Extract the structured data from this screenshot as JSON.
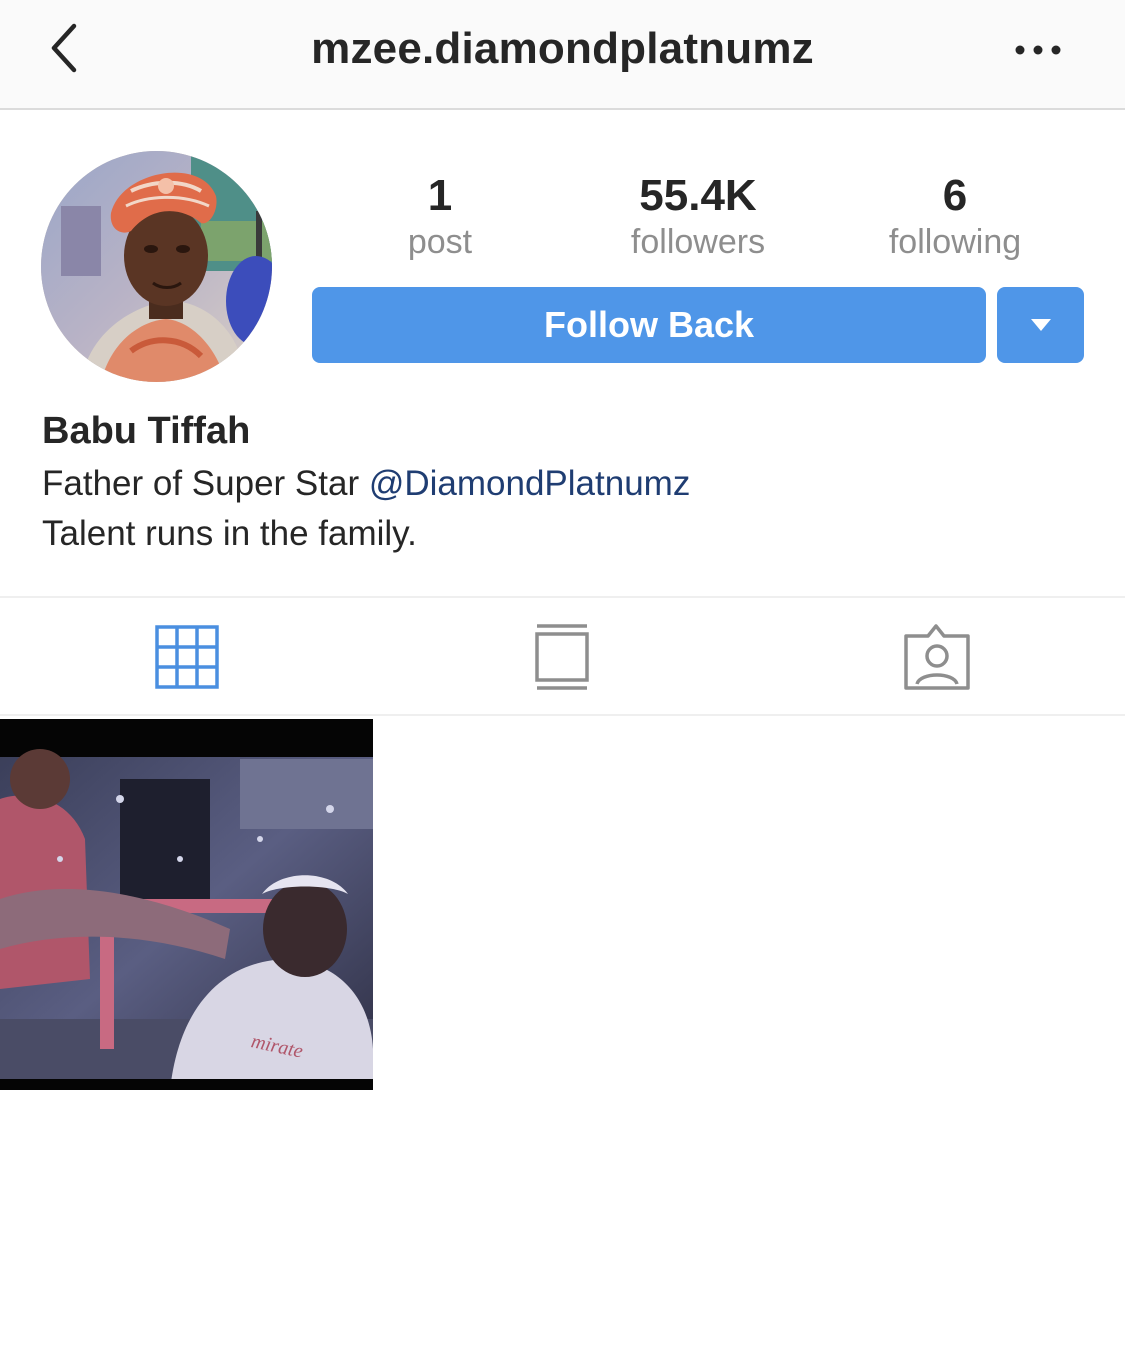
{
  "header": {
    "username": "mzee.diamondplatnumz",
    "back_icon": "chevron-left-icon",
    "more_icon": "more-horizontal-icon"
  },
  "profile": {
    "stats": {
      "posts": {
        "value": "1",
        "label": "post"
      },
      "followers": {
        "value": "55.4K",
        "label": "followers"
      },
      "following": {
        "value": "6",
        "label": "following"
      }
    },
    "follow_button_label": "Follow Back",
    "dropdown_icon": "caret-down-icon",
    "name": "Babu Tiffah",
    "bio_prefix": "Father of Super Star ",
    "bio_mention": "@DiamondPlatnumz",
    "bio_line2": "Talent runs in the family."
  },
  "tabs": [
    {
      "icon": "grid-icon",
      "active": true
    },
    {
      "icon": "feed-icon",
      "active": false
    },
    {
      "icon": "tagged-icon",
      "active": false
    }
  ],
  "post": {
    "thumbnail_text": "mirate"
  },
  "colors": {
    "accent": "#4f96e8",
    "active_tab": "#4a8fe0",
    "mention": "#1f3d72",
    "muted": "#8e8e8e"
  }
}
